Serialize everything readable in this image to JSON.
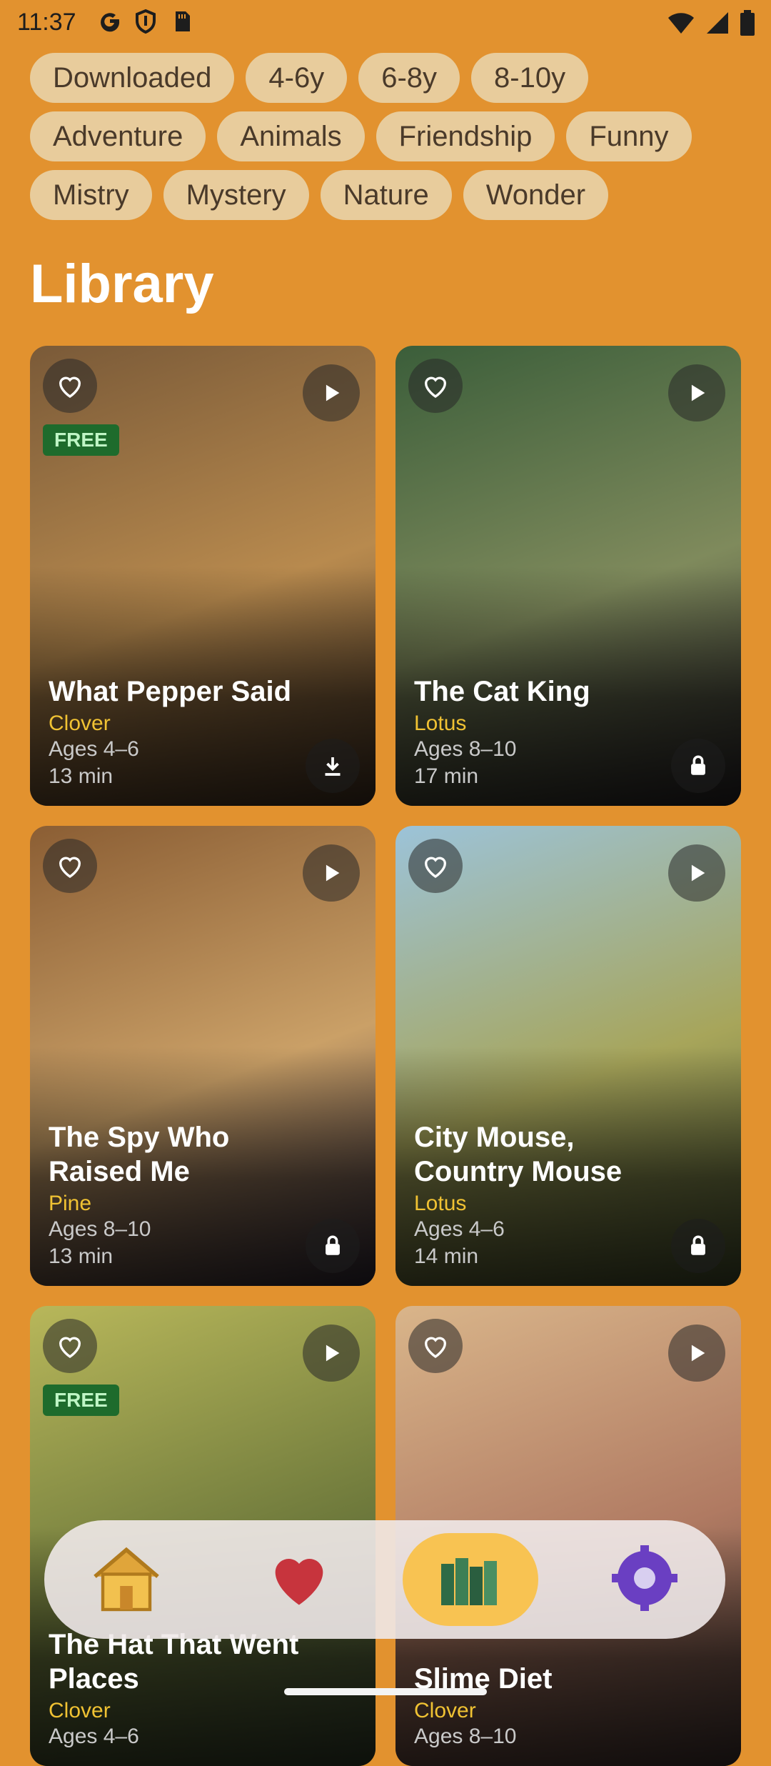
{
  "status_bar": {
    "time": "11:37",
    "icons": [
      "google-icon",
      "shield-icon",
      "sd-card-icon",
      "wifi-icon",
      "signal-icon",
      "battery-icon"
    ]
  },
  "filters": {
    "rows": [
      [
        "Downloaded",
        "4-6y",
        "6-8y",
        "8-10y"
      ],
      [
        "Adventure",
        "Animals",
        "Friendship",
        "Funny"
      ],
      [
        "Mistry",
        "Mystery",
        "Nature",
        "Wonder"
      ]
    ]
  },
  "page_title": "Library",
  "stories": [
    {
      "title": "What Pepper Said",
      "narrator": "Clover",
      "ages": "Ages 4–6",
      "duration": "13 min",
      "badge": "FREE",
      "action_icon": "download-icon",
      "bg_colors": [
        "#7a5a38",
        "#b88a4e",
        "#4f3a28"
      ]
    },
    {
      "title": "The Cat King",
      "narrator": "Lotus",
      "ages": "Ages 8–10",
      "duration": "17 min",
      "badge": "",
      "action_icon": "lock-icon",
      "bg_colors": [
        "#3b5e3a",
        "#7f8a5c",
        "#2f2a2e"
      ]
    },
    {
      "title": "The Spy Who Raised Me",
      "narrator": "Pine",
      "ages": "Ages 8–10",
      "duration": "13 min",
      "badge": "",
      "action_icon": "lock-icon",
      "bg_colors": [
        "#8b5e34",
        "#caa067",
        "#3a3040"
      ]
    },
    {
      "title": "City Mouse, Country Mouse",
      "narrator": "Lotus",
      "ages": "Ages 4–6",
      "duration": "14 min",
      "badge": "",
      "action_icon": "lock-icon",
      "bg_colors": [
        "#9cc3d9",
        "#a7a55a",
        "#4f5b34"
      ]
    },
    {
      "title": "The Hat That Went Places",
      "narrator": "Clover",
      "ages": "Ages 4–6",
      "duration": "",
      "badge": "FREE",
      "action_icon": "download-icon",
      "bg_colors": [
        "#b8b75a",
        "#6f7a3c",
        "#3b4a33"
      ]
    },
    {
      "title": "Slime Diet",
      "narrator": "Clover",
      "ages": "Ages 8–10",
      "duration": "",
      "badge": "",
      "action_icon": "lock-icon",
      "bg_colors": [
        "#d9b58a",
        "#b07a62",
        "#4e3d3a"
      ]
    }
  ],
  "nav": {
    "items": [
      {
        "name": "home-icon",
        "selected": false
      },
      {
        "name": "heart-icon",
        "selected": false
      },
      {
        "name": "books-icon",
        "selected": true
      },
      {
        "name": "settings-icon",
        "selected": false
      }
    ]
  }
}
